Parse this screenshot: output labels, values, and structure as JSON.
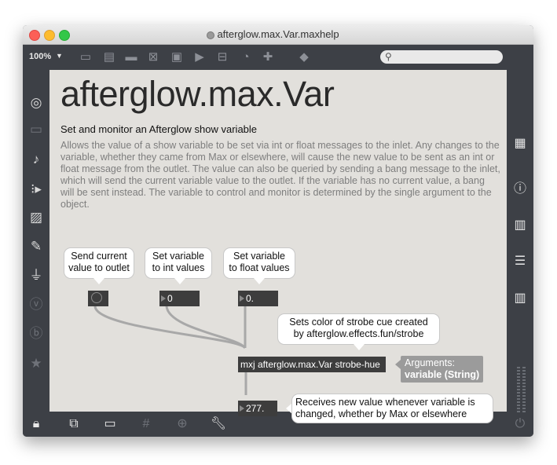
{
  "window": {
    "title": "afterglow.max.Var.maxhelp"
  },
  "toolbar": {
    "zoom": "100%",
    "zoom_arrow": "▼",
    "icons": [
      "presentation-view-icon",
      "comment-icon",
      "speech-icon",
      "x-box-icon",
      "target-box-icon",
      "play-box-icon",
      "split-icon",
      "gauge-icon",
      "plus-icon",
      "paint-bucket-icon"
    ],
    "search_placeholder": ""
  },
  "left_sidebar": {
    "icons": [
      "target-icon",
      "keyboard-icon",
      "music-note-icon",
      "sequence-icon",
      "image-icon",
      "paperclip-icon",
      "plug-icon",
      "v-icon",
      "b-icon",
      "star-icon"
    ]
  },
  "right_sidebar": {
    "icons": [
      "grid-icon",
      "info-icon",
      "book-icon",
      "list-icon",
      "reference-icon"
    ]
  },
  "bottom_bar": {
    "icons": [
      "lock-icon",
      "windows-icon",
      "presentation-icon",
      "grid-icon",
      "snap-icon",
      "wrench-icon",
      "power-icon"
    ]
  },
  "patch": {
    "title": "afterglow.max.Var",
    "subtitle": "Set and monitor an Afterglow show variable",
    "description": "Allows the value of a show variable to be set via int or float messages to the inlet. Any changes to the variable, whether they came from Max or elsewhere, will cause the new value to be sent as an int or float message from the outlet. The value can also be queried by sending a bang message to the inlet, which will send the current variable value to the outlet. If the variable has no current value, a bang will be sent instead. The variable to control and monitor is determined by the single argument to the object.",
    "comments": {
      "send_current_line1": "Send current",
      "send_current_line2": "value to outlet",
      "set_int_line1": "Set variable",
      "set_int_line2": "to int values",
      "set_float_line1": "Set variable",
      "set_float_line2": "to float values",
      "strobe_line1": "Sets color of strobe cue created",
      "strobe_line2": "by afterglow.effects.fun/strobe",
      "receives_line1": "Receives new value whenever variable is",
      "receives_line2": "changed, whether by Max or elsewhere"
    },
    "int_box_value": "0",
    "float_box_value": "0.",
    "object_text": "mxj afterglow.max.Var strobe-hue",
    "arguments_label": "Arguments:",
    "arguments_value": "variable (String)",
    "output_value": "277."
  }
}
